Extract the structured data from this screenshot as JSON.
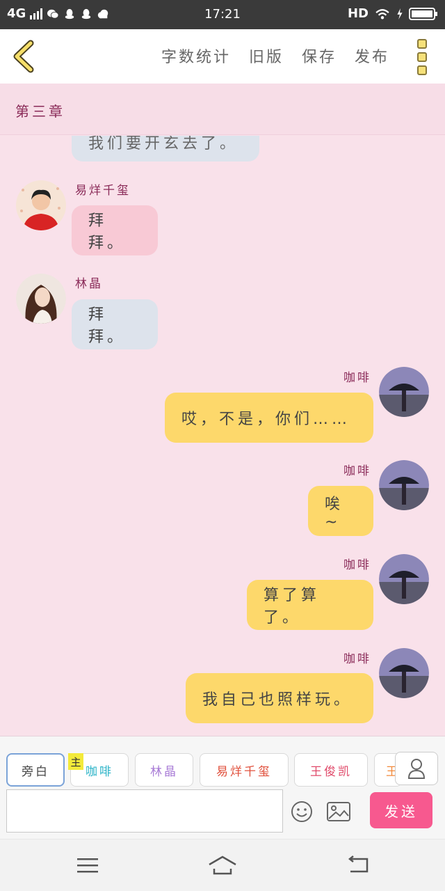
{
  "status_bar": {
    "network": "4G",
    "time": "17:21",
    "hd": "HD"
  },
  "toolbar": {
    "items": [
      "字数统计",
      "旧版",
      "保存",
      "发布"
    ]
  },
  "chapter": {
    "title": "第三章"
  },
  "messages": [
    {
      "side": "left",
      "speaker": "",
      "text": "我们要开玄去了。",
      "bubble_color": "#dde3ec"
    },
    {
      "side": "left",
      "speaker": "易烊千玺",
      "text": "拜拜。",
      "bubble_color": "#f8c9d5"
    },
    {
      "side": "left",
      "speaker": "林晶",
      "text": "拜拜。",
      "bubble_color": "#dde3ec"
    },
    {
      "side": "right",
      "speaker": "咖啡",
      "text": "哎，不是，你们……",
      "bubble_color": "#fdd86b"
    },
    {
      "side": "right",
      "speaker": "咖啡",
      "text": "唉~",
      "bubble_color": "#fdd86b"
    },
    {
      "side": "right",
      "speaker": "咖啡",
      "text": "算了算了。",
      "bubble_color": "#fdd86b"
    },
    {
      "side": "right",
      "speaker": "咖啡",
      "text": "我自己也照样玩。",
      "bubble_color": "#fdd86b"
    }
  ],
  "role_bar": {
    "chips": [
      {
        "label": "旁白",
        "color": "#555555"
      },
      {
        "label": "咖啡",
        "color": "#2ab3c7"
      },
      {
        "label": "林晶",
        "color": "#a87bd6"
      },
      {
        "label": "易烊千玺",
        "color": "#e0503c"
      },
      {
        "label": "王俊凯",
        "color": "#e04a6a"
      },
      {
        "label": "王",
        "color": "#f28a3c"
      }
    ],
    "main_badge": "主"
  },
  "input": {
    "placeholder": "",
    "send_label": "发送"
  },
  "colors": {
    "accent": "#f7598f",
    "background": "#f9e1ea",
    "name": "#8a2a58"
  }
}
